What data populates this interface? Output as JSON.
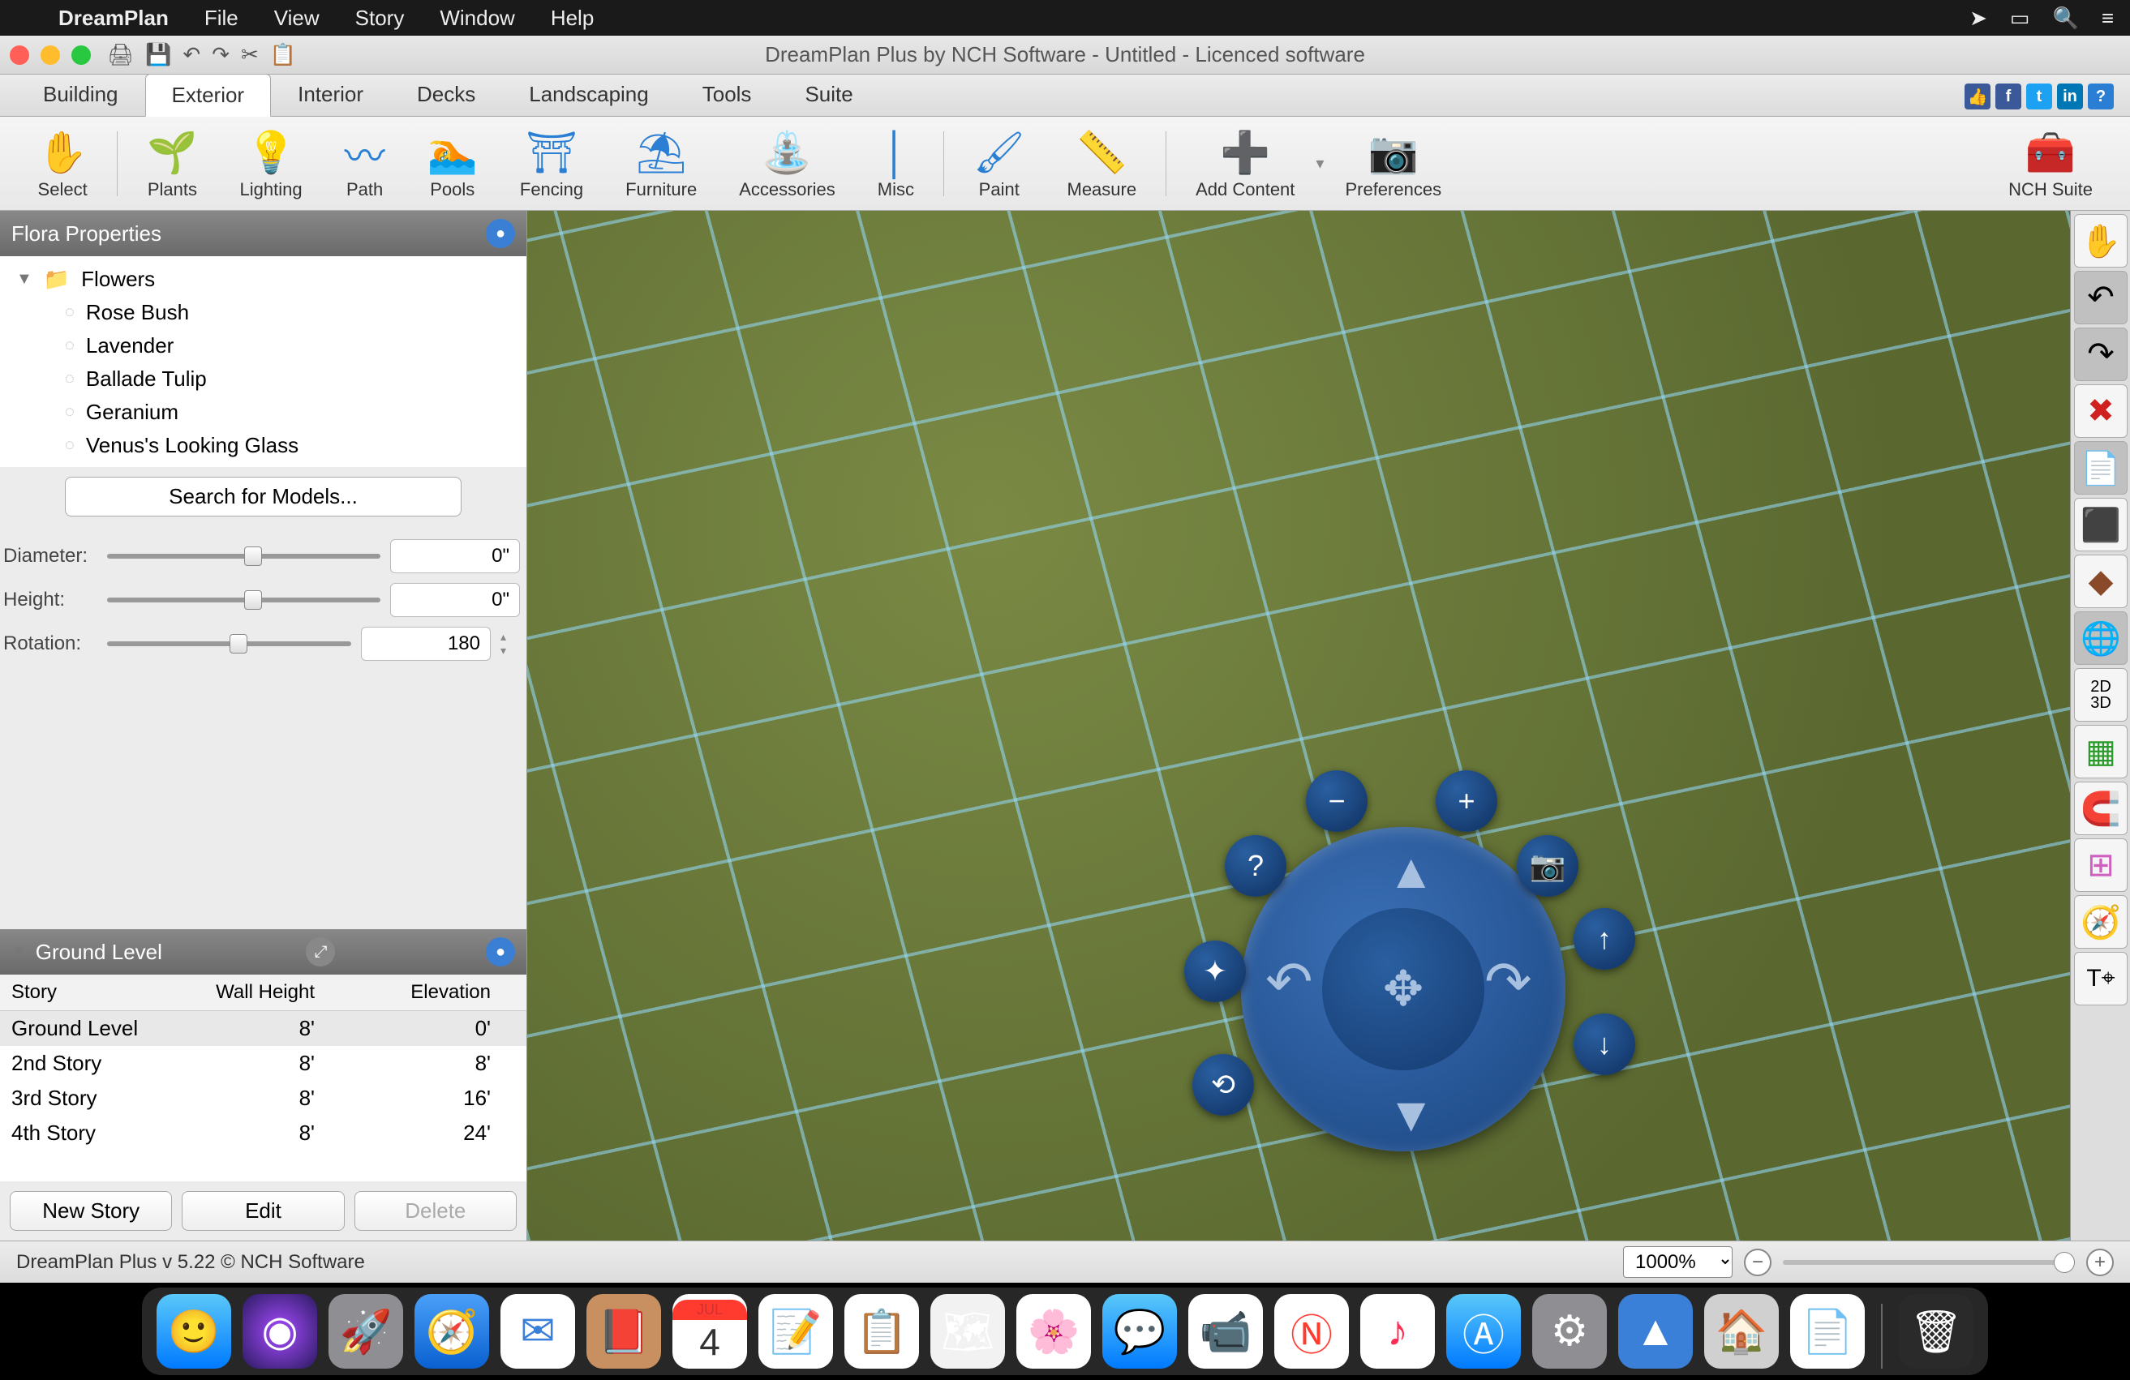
{
  "menubar": {
    "app_name": "DreamPlan",
    "items": [
      "File",
      "View",
      "Story",
      "Window",
      "Help"
    ]
  },
  "window_title": "DreamPlan Plus by NCH Software - Untitled - Licenced software",
  "main_tabs": [
    "Building",
    "Exterior",
    "Interior",
    "Decks",
    "Landscaping",
    "Tools",
    "Suite"
  ],
  "active_tab_index": 1,
  "toolbar": {
    "items": [
      "Select",
      "Plants",
      "Lighting",
      "Path",
      "Pools",
      "Fencing",
      "Furniture",
      "Accessories",
      "Misc",
      "Paint",
      "Measure",
      "Add Content",
      "Preferences"
    ],
    "right_item": "NCH Suite"
  },
  "flora_panel": {
    "title": "Flora Properties",
    "folder": "Flowers",
    "items": [
      "Rose Bush",
      "Lavender",
      "Ballade Tulip",
      "Geranium",
      "Venus's Looking Glass"
    ],
    "search_label": "Search for Models...",
    "props": {
      "diameter_label": "Diameter:",
      "diameter_value": "0\"",
      "height_label": "Height:",
      "height_value": "0\"",
      "rotation_label": "Rotation:",
      "rotation_value": "180"
    }
  },
  "ground_panel": {
    "title": "Ground Level",
    "headers": [
      "Story",
      "Wall Height",
      "Elevation"
    ],
    "rows": [
      {
        "name": "Ground Level",
        "wall": "8'",
        "elev": "0'"
      },
      {
        "name": "2nd Story",
        "wall": "8'",
        "elev": "8'"
      },
      {
        "name": "3rd Story",
        "wall": "8'",
        "elev": "16'"
      },
      {
        "name": "4th Story",
        "wall": "8'",
        "elev": "24'"
      }
    ],
    "buttons": {
      "new": "New Story",
      "edit": "Edit",
      "delete": "Delete"
    }
  },
  "status": {
    "text": "DreamPlan Plus v 5.22 © NCH Software",
    "zoom": "1000%"
  },
  "dock_items": [
    "Finder",
    "Siri",
    "Launchpad",
    "Safari",
    "Mail",
    "Contacts",
    "Calendar",
    "Notes",
    "Reminders",
    "Maps",
    "Photos",
    "Messages",
    "FaceTime",
    "News",
    "Music",
    "AppStore",
    "Preferences",
    "Affinity",
    "DreamPlan",
    "TextEdit",
    "Trash"
  ],
  "calendar_day": "4"
}
